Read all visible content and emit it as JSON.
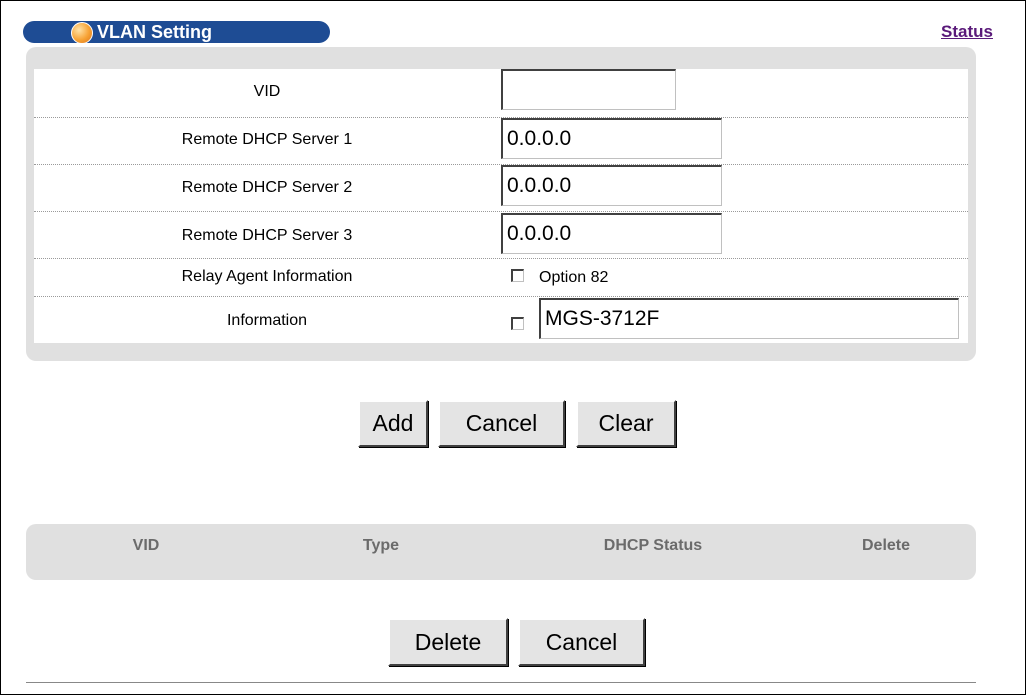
{
  "header": {
    "title": "VLAN Setting",
    "status_link": "Status"
  },
  "form": {
    "vid_label": "VID",
    "vid_value": "",
    "dhcp1_label": "Remote DHCP Server 1",
    "dhcp1_value": "0.0.0.0",
    "dhcp2_label": "Remote DHCP Server 2",
    "dhcp2_value": "0.0.0.0",
    "dhcp3_label": "Remote DHCP Server 3",
    "dhcp3_value": "0.0.0.0",
    "relay_label": "Relay Agent Information",
    "option82_label": "Option 82",
    "option82_checked": false,
    "info_label": "Information",
    "info_checked": false,
    "info_value": "MGS-3712F"
  },
  "form_buttons": {
    "add": "Add",
    "cancel": "Cancel",
    "clear": "Clear"
  },
  "table": {
    "columns": [
      "VID",
      "Type",
      "DHCP Status",
      "Delete"
    ],
    "rows": []
  },
  "table_buttons": {
    "delete": "Delete",
    "cancel": "Cancel"
  },
  "colors": {
    "title_bar": "#1e4c94",
    "panel_gray": "#e0e0e0",
    "link": "#5a1a7a",
    "header_text": "#6b6b6b"
  }
}
